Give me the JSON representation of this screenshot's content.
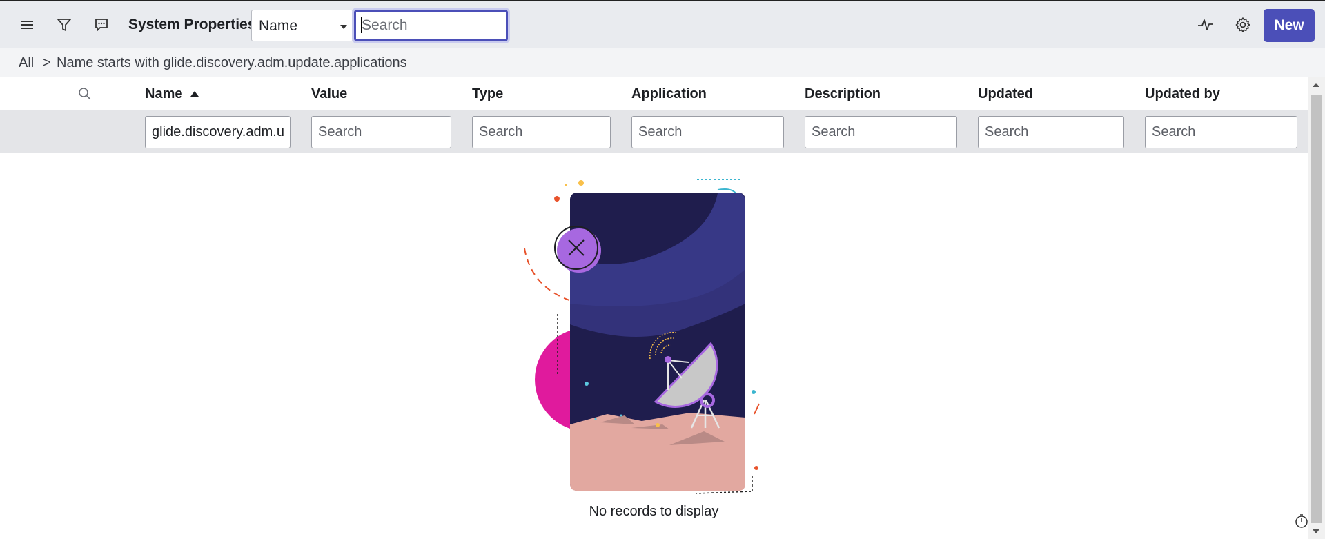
{
  "header": {
    "title": "System Properties",
    "field_select": "Name",
    "search_placeholder": "Search",
    "new_label": "New",
    "icons": [
      "menu-icon",
      "filter-icon",
      "comment-icon",
      "activity-icon",
      "gear-icon"
    ]
  },
  "breadcrumb": {
    "all": "All",
    "separator": ">",
    "condition": "Name starts with glide.discovery.adm.update.applications"
  },
  "table": {
    "columns": [
      "Name",
      "Value",
      "Type",
      "Application",
      "Description",
      "Updated",
      "Updated by"
    ],
    "sort_column": "Name",
    "filters": {
      "name_value": "glide.discovery.adm.update.applications",
      "placeholder": "Search"
    }
  },
  "empty_state": {
    "message": "No records to display"
  },
  "colors": {
    "accent": "#4b4fb8",
    "toolbar_bg": "#e9ebef",
    "filter_row_bg": "#e4e5e8"
  }
}
